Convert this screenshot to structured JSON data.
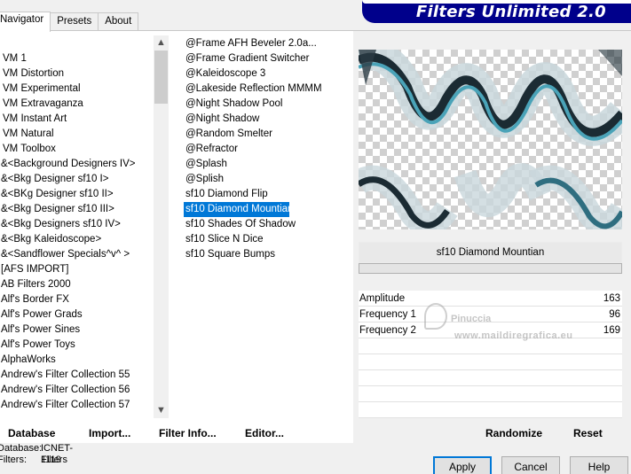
{
  "tabs": [
    {
      "label": "Navigator"
    },
    {
      "label": "Presets"
    },
    {
      "label": "About"
    }
  ],
  "banner": {
    "title": "Filters Unlimited 2.0"
  },
  "category_list": [
    "VM 1",
    "VM Distortion",
    "VM Experimental",
    "VM Extravaganza",
    "VM Instant Art",
    "VM Natural",
    "VM Toolbox",
    "&<Background Designers IV>",
    "&<Bkg Designer sf10 I>",
    "&<BKg Designer sf10 II>",
    "&<Bkg Designer sf10 III>",
    "&<Bkg Designers sf10 IV>",
    "&<Bkg Kaleidoscope>",
    "&<Sandflower Specials^v^ >",
    "[AFS IMPORT]",
    "AB Filters 2000",
    "Alf's Border FX",
    "Alf's Power Grads",
    "Alf's Power Sines",
    "Alf's Power Toys",
    "AlphaWorks",
    "Andrew's Filter Collection 55",
    "Andrew's Filter Collection 56",
    "Andrew's Filter Collection 57"
  ],
  "filter_list": [
    "@Frame AFH Beveler 2.0a...",
    "@Frame Gradient Switcher",
    "@Kaleidoscope 3",
    "@Lakeside Reflection MMMM",
    "@Night Shadow Pool",
    "@Night Shadow",
    "@Random Smelter",
    "@Refractor",
    "@Splash",
    "@Splish",
    "sf10 Diamond Flip",
    "sf10 Diamond Mountian",
    "sf10 Shades Of Shadow",
    "sf10 Slice N Dice",
    "sf10 Square Bumps"
  ],
  "selected_filter_index": 11,
  "preview": {
    "filter_name": "sf10 Diamond Mountian"
  },
  "params": [
    {
      "label": "Amplitude",
      "value": "163"
    },
    {
      "label": "Frequency 1",
      "value": "96"
    },
    {
      "label": "Frequency 2",
      "value": "169"
    }
  ],
  "watermark": {
    "line1": "Pinuccia",
    "line2": "www.maildiregrafica.eu"
  },
  "bottom_buttons": {
    "database": "Database",
    "import": "Import...",
    "filter_info": "Filter Info...",
    "editor": "Editor...",
    "randomize": "Randomize",
    "reset": "Reset"
  },
  "db_info": {
    "database_label": "Database:",
    "database_value": "ICNET-Filters",
    "filters_label": "Filters:",
    "filters_value": "1119"
  },
  "dialog_buttons": {
    "apply": "Apply",
    "cancel": "Cancel",
    "help": "Help"
  },
  "scroll_icons": {
    "up": "chevron-up-icon",
    "down": "chevron-down-icon"
  },
  "colors": {
    "selection": "#0078d7",
    "banner": "#00008b",
    "preview_accent": "#4aa3b8"
  }
}
